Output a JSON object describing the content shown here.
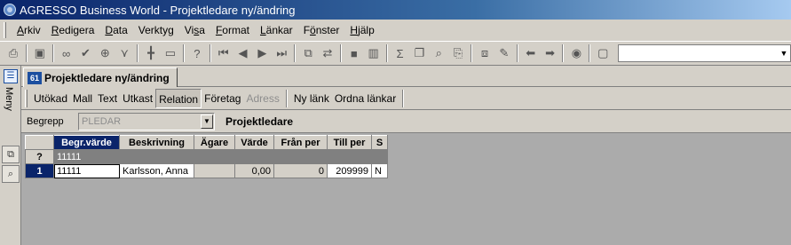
{
  "window": {
    "title": "AGRESSO Business World - Projektledare ny/ändring"
  },
  "menu": [
    {
      "label": "Arkiv",
      "u": "A",
      "rest": "rkiv"
    },
    {
      "label": "Redigera",
      "u": "R",
      "rest": "edigera"
    },
    {
      "label": "Data",
      "u": "D",
      "rest": "ata"
    },
    {
      "label": "Verktyg",
      "pre": "Verkty",
      "u": "g",
      "rest": ""
    },
    {
      "label": "Visa",
      "pre": "Vi",
      "u": "s",
      "rest": "a"
    },
    {
      "label": "Format",
      "u": "F",
      "rest": "ormat"
    },
    {
      "label": "Länkar",
      "u": "L",
      "rest": "änkar"
    },
    {
      "label": "Fönster",
      "pre": "F",
      "u": "ö",
      "rest": "nster"
    },
    {
      "label": "Hjälp",
      "u": "H",
      "rest": "jälp"
    }
  ],
  "sidebar": {
    "menu_label": "Meny"
  },
  "tab": {
    "icon_text": "61",
    "label": "Projektledare ny/ändring"
  },
  "actions": {
    "utokad": "Utökad",
    "mall": "Mall",
    "text": "Text",
    "utkast": "Utkast",
    "relation": "Relation",
    "foretag": "Företag",
    "adress": "Adress",
    "ny_lank": "Ny länk",
    "ordna_lankar": "Ordna länkar"
  },
  "begrepp": {
    "label": "Begrepp",
    "value": "PLEDAR",
    "description": "Projektledare"
  },
  "grid": {
    "headers": [
      "Begr.värde",
      "Beskrivning",
      "Ägare",
      "Värde",
      "Från per",
      "Till per",
      "S"
    ],
    "filter_row": {
      "marker": "?",
      "begr_varde": "11111"
    },
    "rows": [
      {
        "num": "1",
        "begr_varde": "11111",
        "beskrivning": "Karlsson, Anna",
        "agare": "",
        "varde": "0,00",
        "fran_per": "0",
        "till_per": "209999",
        "s": "N"
      }
    ]
  },
  "colors": {
    "title_start": "#0a246a",
    "title_end": "#a6caf0",
    "selection": "#0a246a",
    "grid_bg": "#ababab"
  }
}
